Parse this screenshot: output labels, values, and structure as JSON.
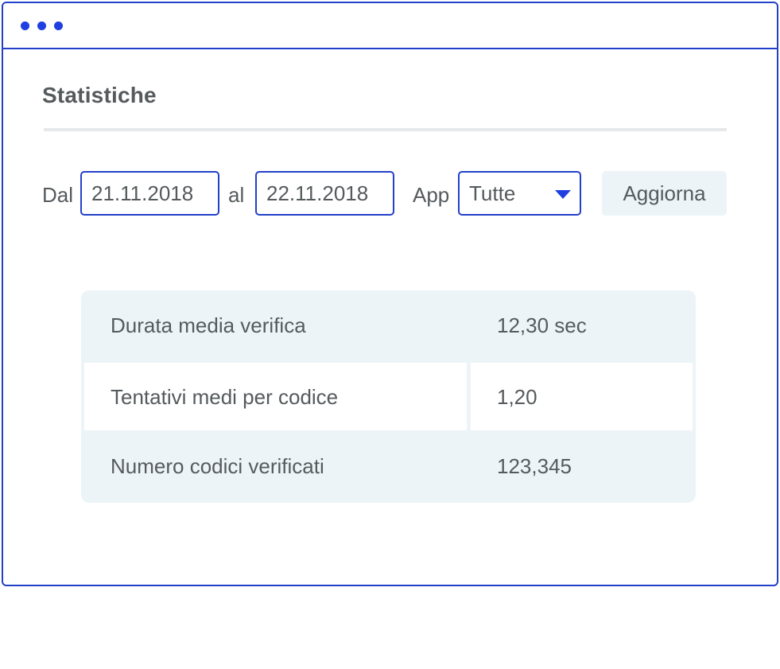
{
  "window": {
    "dots": [
      "dot",
      "dot",
      "dot"
    ]
  },
  "page": {
    "title": "Statistiche"
  },
  "filters": {
    "from_label": "Dal",
    "from_value": "21.11.2018",
    "to_label": "al",
    "to_value": "22.11.2018",
    "app_label": "App",
    "app_selected": "Tutte",
    "refresh_label": "Aggiorna"
  },
  "stats": {
    "rows": [
      {
        "label": "Durata media verifica",
        "value": "12,30 sec"
      },
      {
        "label": "Tentativi medi per codice",
        "value": "1,20"
      },
      {
        "label": "Numero codici verificati",
        "value": "123,345"
      }
    ]
  },
  "colors": {
    "accent": "#2340c8",
    "dot": "#1f3fe0",
    "text": "#555a5d",
    "panel_bg": "#edf4f7",
    "divider": "#e6e8e9"
  }
}
